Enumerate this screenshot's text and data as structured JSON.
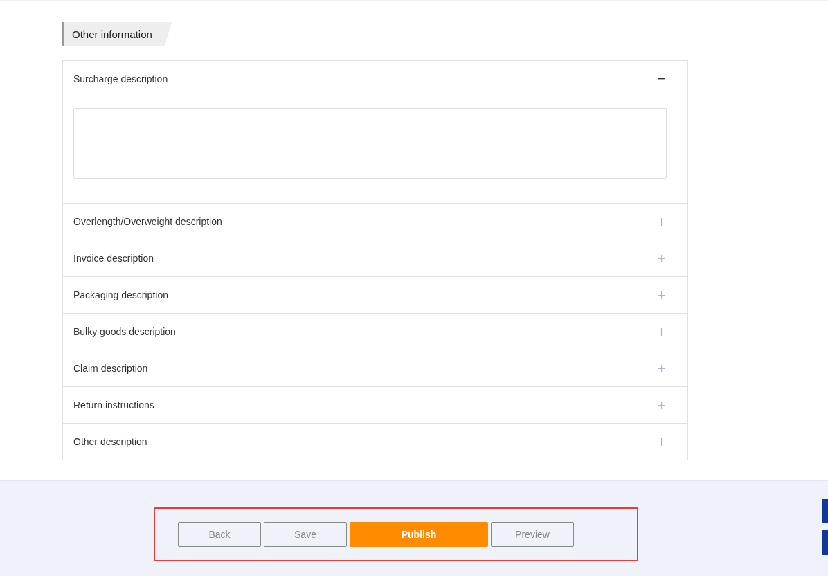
{
  "section": {
    "title": "Other information"
  },
  "accordion": [
    {
      "label": "Surcharge description",
      "expanded": true
    },
    {
      "label": "Overlength/Overweight description",
      "expanded": false
    },
    {
      "label": "Invoice description",
      "expanded": false
    },
    {
      "label": "Packaging description",
      "expanded": false
    },
    {
      "label": "Bulky goods description",
      "expanded": false
    },
    {
      "label": "Claim description",
      "expanded": false
    },
    {
      "label": "Return instructions",
      "expanded": false
    },
    {
      "label": "Other description",
      "expanded": false
    }
  ],
  "footer": {
    "buttons": [
      {
        "label": "Back",
        "kind": "secondary"
      },
      {
        "label": "Save",
        "kind": "secondary"
      },
      {
        "label": "Publish",
        "kind": "primary"
      },
      {
        "label": "Preview",
        "kind": "secondary"
      }
    ]
  }
}
